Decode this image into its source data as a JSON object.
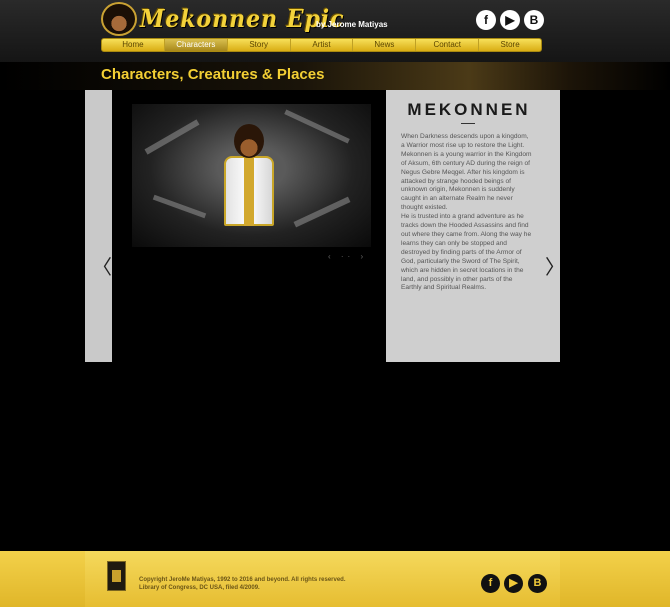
{
  "header": {
    "logo_text": "Mekonnen Epic",
    "logo_byline": "by Jerome Matiyas",
    "social": {
      "facebook": "f",
      "youtube": "▶",
      "blogger": "B"
    }
  },
  "nav": {
    "items": [
      "Home",
      "Characters",
      "Story",
      "Artist",
      "News",
      "Contact",
      "Store"
    ],
    "active": "Characters"
  },
  "page": {
    "title": "Characters, Creatures & Places"
  },
  "slider": {
    "prev_icon": "chevron-left-icon",
    "next_icon": "chevron-right-icon",
    "prev_glyph": "〈",
    "next_glyph": "〉",
    "thumb_nav": "‹ ·· ›",
    "character": {
      "name": "MEKONNEN",
      "paragraph1": "When Darkness descends upon a kingdom, a Warrior most rise up to restore the Light. Mekonnen is a young warrior in the Kingdom of Aksum, 6th century AD during the reign of Negus Gebre Meqgel. After his kingdom is attacked by strange hooded beings of unknown origin, Mekonnen is suddenly caught in an alternate Realm he never thought existed.",
      "paragraph2": "He is trusted into a grand adventure as he tracks down the  Hooded Assassins and find out where they came from. Along the way he learns they can only be stopped and destroyed by finding parts of the Armor of God, particularly the Sword of The Spirit, which are hidden in secret locations in the land, and possibly in other parts of the Earthly and Spiritual Realms."
    }
  },
  "footer": {
    "copyright_line1": "Copyright JeroMe Matiyas, 1992 to 2016 and beyond. All rights reserved.",
    "copyright_line2": "Library of Congress, DC USA, filed 4/2009.",
    "social": {
      "facebook": "f",
      "youtube": "▶",
      "blogger": "B"
    }
  },
  "colors": {
    "accent": "#f3cf34",
    "panel": "#cfcfcf",
    "background": "#000000"
  }
}
